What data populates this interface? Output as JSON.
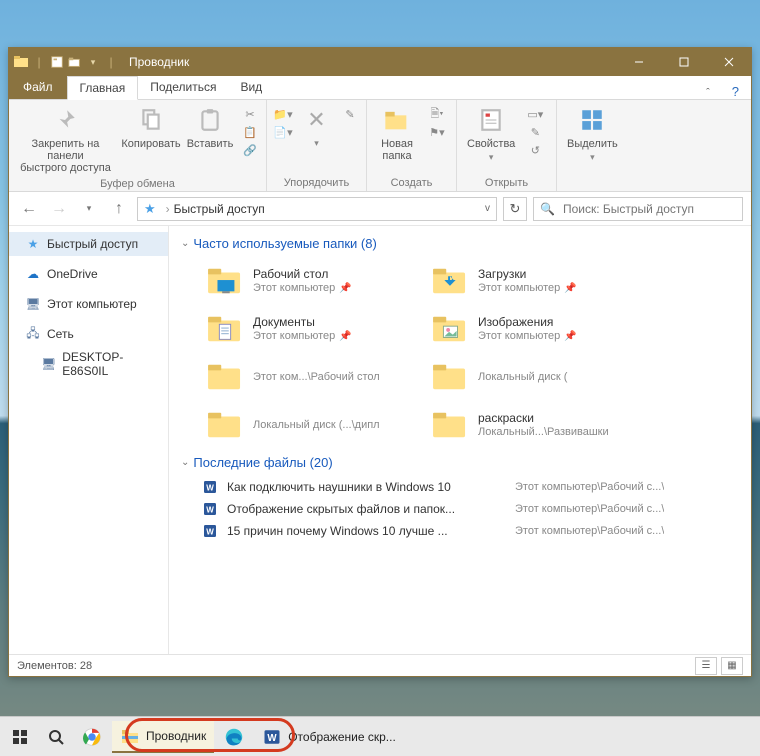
{
  "title": "Проводник",
  "tabs": {
    "file": "Файл",
    "home": "Главная",
    "share": "Поделиться",
    "view": "Вид"
  },
  "ribbon": {
    "pin": "Закрепить на панели\nбыстрого доступа",
    "copy": "Копировать",
    "paste": "Вставить",
    "clipboard_cap": "Буфер обмена",
    "organize_cap": "Упорядочить",
    "newfolder": "Новая\nпапка",
    "create_cap": "Создать",
    "props": "Свойства",
    "open_cap": "Открыть",
    "select": "Выделить"
  },
  "address": {
    "crumb": "Быстрый доступ"
  },
  "search": {
    "placeholder": "Поиск: Быстрый доступ"
  },
  "nav": {
    "quick": "Быстрый доступ",
    "onedrive": "OneDrive",
    "thispc": "Этот компьютер",
    "network": "Сеть",
    "host": "DESKTOP-E86S0IL"
  },
  "groups": {
    "freq": "Часто используемые папки (8)",
    "recent": "Последние файлы (20)"
  },
  "folders": [
    {
      "name": "Рабочий стол",
      "sub": "Этот компьютер",
      "icon": "desktop",
      "pin": true
    },
    {
      "name": "Загрузки",
      "sub": "Этот компьютер",
      "icon": "downloads",
      "pin": true
    },
    {
      "name": "Документы",
      "sub": "Этот компьютер",
      "icon": "documents",
      "pin": true
    },
    {
      "name": "Изображения",
      "sub": "Этот компьютер",
      "icon": "pictures",
      "pin": true
    },
    {
      "name": "",
      "sub": "Этот ком...\\Рабочий стол",
      "icon": "folder",
      "pin": false
    },
    {
      "name": "",
      "sub": "Локальный диск (",
      "icon": "folder",
      "pin": false
    },
    {
      "name": "",
      "sub": "Локальный диск (...\\дипл",
      "icon": "folder",
      "pin": false
    },
    {
      "name": "раскраски",
      "sub": "Локальный...\\Развивашки",
      "icon": "folder",
      "pin": false
    }
  ],
  "recent": [
    {
      "name": "Как подключить наушники в Windows 10",
      "path": "Этот компьютер\\Рабочий с...\\"
    },
    {
      "name": "Отображение скрытых файлов и папок...",
      "path": "Этот компьютер\\Рабочий с...\\"
    },
    {
      "name": "15 причин почему Windows 10 лучше ...",
      "path": "Этот компьютер\\Рабочий с...\\"
    }
  ],
  "status": {
    "count": "Элементов: 28"
  },
  "taskbar": {
    "explorer": "Проводник",
    "word": "Отображение скр..."
  }
}
